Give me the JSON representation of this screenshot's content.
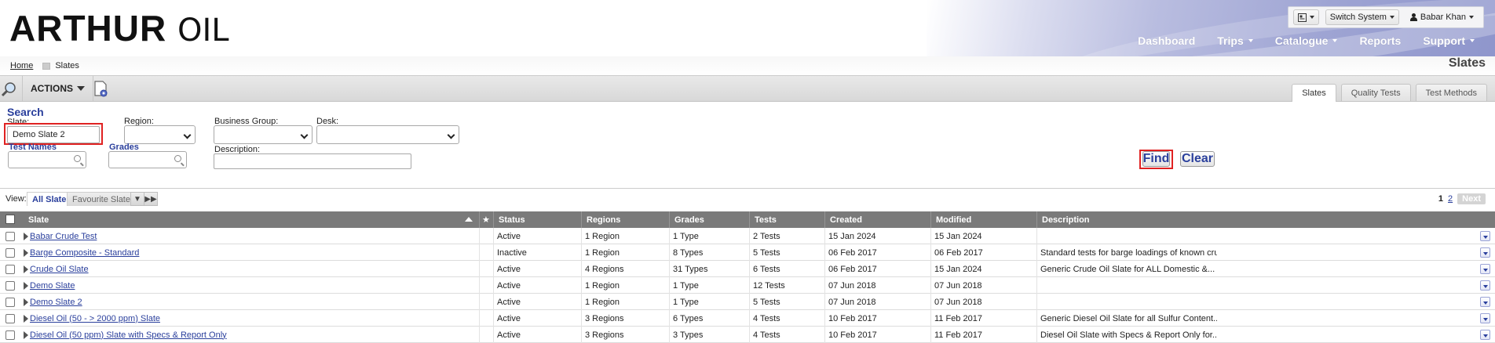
{
  "header": {
    "logo_bold": "ARTHUR",
    "logo_light": "OIL",
    "switch_system": "Switch System",
    "user_name": "Babar Khan",
    "nav": [
      {
        "label": "Dashboard"
      },
      {
        "label": "Trips"
      },
      {
        "label": "Catalogue"
      },
      {
        "label": "Reports"
      },
      {
        "label": "Support"
      }
    ]
  },
  "breadcrumb": {
    "home": "Home",
    "current": "Slates"
  },
  "page_title": "Slates",
  "toolbar": {
    "actions_label": "ACTIONS",
    "tabs": [
      {
        "label": "Slates",
        "active": true
      },
      {
        "label": "Quality Tests",
        "active": false
      },
      {
        "label": "Test Methods",
        "active": false
      }
    ]
  },
  "search": {
    "title": "Search",
    "slate_label": "Slate:",
    "slate_value": "Demo Slate 2",
    "region_label": "Region:",
    "business_group_label": "Business Group:",
    "desk_label": "Desk:",
    "test_names_label": "Test Names",
    "grades_label": "Grades",
    "description_label": "Description:",
    "find_label": "Find",
    "clear_label": "Clear"
  },
  "view": {
    "label": "View:",
    "tabs": [
      "All Slates",
      "Favourite Slates"
    ],
    "pager": {
      "current": "1",
      "other": "2",
      "next": "Next"
    }
  },
  "table": {
    "columns": [
      "Slate",
      "Status",
      "Regions",
      "Grades",
      "Tests",
      "Created",
      "Modified",
      "Description"
    ],
    "rows": [
      [
        "Babar Crude Test",
        "Active",
        "1 Region",
        "1 Type",
        "2 Tests",
        "15 Jan 2024",
        "15 Jan 2024",
        ""
      ],
      [
        "Barge Composite - Standard",
        "Inactive",
        "1 Region",
        "8 Types",
        "5 Tests",
        "06 Feb 2017",
        "06 Feb 2017",
        "Standard tests for barge loadings of known crudes"
      ],
      [
        "Crude Oil Slate",
        "Active",
        "4 Regions",
        "31 Types",
        "6 Tests",
        "06 Feb 2017",
        "15 Jan 2024",
        "Generic Crude Oil Slate for ALL Domestic &..."
      ],
      [
        "Demo Slate",
        "Active",
        "1 Region",
        "1 Type",
        "12 Tests",
        "07 Jun 2018",
        "07 Jun 2018",
        ""
      ],
      [
        "Demo Slate 2",
        "Active",
        "1 Region",
        "1 Type",
        "5 Tests",
        "07 Jun 2018",
        "07 Jun 2018",
        ""
      ],
      [
        "Diesel Oil (50 - > 2000 ppm) Slate",
        "Active",
        "3 Regions",
        "6 Types",
        "4 Tests",
        "10 Feb 2017",
        "11 Feb 2017",
        "Generic Diesel Oil Slate for all Sulfur Content..."
      ],
      [
        "Diesel Oil (50 ppm) Slate with Specs & Report Only",
        "Active",
        "3 Regions",
        "3 Types",
        "4 Tests",
        "10 Feb 2017",
        "11 Feb 2017",
        "Diesel Oil Slate with Specs & Report Only for..."
      ]
    ]
  },
  "colors": {
    "accent": "#2a3f9c",
    "highlight": "#e02222",
    "header_gray": "#7a7a7a"
  }
}
